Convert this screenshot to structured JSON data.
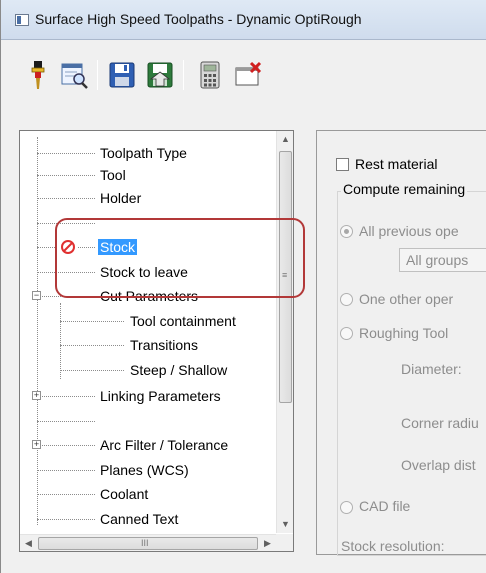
{
  "window": {
    "title": "Surface High Speed Toolpaths - Dynamic OptiRough"
  },
  "toolbar": {
    "buttons": [
      {
        "name": "tool-icon"
      },
      {
        "name": "view-sheet-icon"
      },
      {
        "name": "save-icon"
      },
      {
        "name": "load-icon"
      },
      {
        "name": "calculator-icon"
      },
      {
        "name": "close-sheet-icon"
      }
    ]
  },
  "tree": {
    "items": [
      {
        "label": "Toolpath Type",
        "level": 1,
        "icon": "dotted-line"
      },
      {
        "label": "Tool",
        "level": 1,
        "icon": "dotted-line"
      },
      {
        "label": "Holder",
        "level": 1,
        "icon": "dotted-line"
      },
      {
        "label": "",
        "level": 1,
        "icon": "dotted-line"
      },
      {
        "label": "Stock",
        "level": 1,
        "icon": "prohibited-icon",
        "selected": true
      },
      {
        "label": "Stock to leave",
        "level": 1,
        "icon": "dotted-line"
      },
      {
        "label": "Cut Parameters",
        "level": 1,
        "expander": "minus"
      },
      {
        "label": "Tool containment",
        "level": 2
      },
      {
        "label": "Transitions",
        "level": 2
      },
      {
        "label": "Steep / Shallow",
        "level": 2
      },
      {
        "label": "Linking Parameters",
        "level": 1,
        "expander": "plus"
      },
      {
        "label": "",
        "level": 1
      },
      {
        "label": "Arc Filter / Tolerance",
        "level": 1,
        "expander": "plus"
      },
      {
        "label": "Planes (WCS)",
        "level": 1
      },
      {
        "label": "Coolant",
        "level": 1
      },
      {
        "label": "Canned Text",
        "level": 1
      }
    ],
    "hscroll_grip": "III"
  },
  "right": {
    "rest_material": "Rest material",
    "compute_remaining": "Compute remaining",
    "all_previous": "All previous ope",
    "all_groups": "All groups",
    "one_other": "One other oper",
    "roughing_tool": "Roughing Tool",
    "diameter": "Diameter:",
    "corner_radius": "Corner radiu",
    "overlap_dist": "Overlap dist",
    "cad_file": "CAD file",
    "stock_resolution": "Stock resolution:"
  },
  "colors": {
    "selection": "#3399ff",
    "highlight_border": "#b23838",
    "prohibited": "#e03030"
  }
}
